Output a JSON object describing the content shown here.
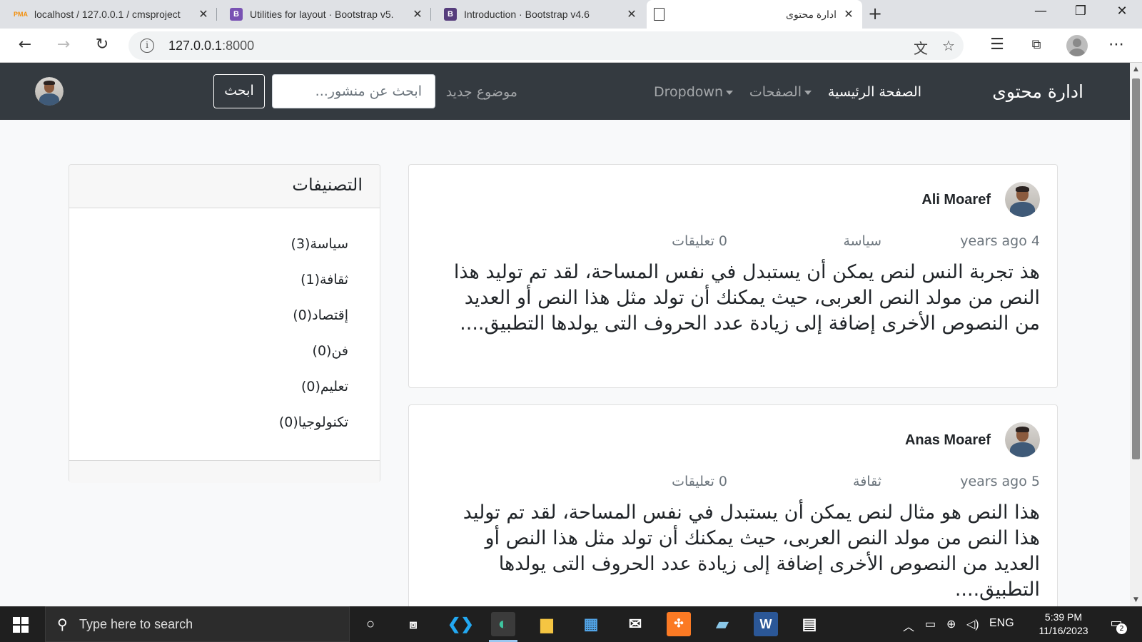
{
  "browser": {
    "tabs": [
      {
        "title": "localhost / 127.0.0.1 / cmsproject",
        "favicon": "PMA"
      },
      {
        "title": "Utilities for layout · Bootstrap v5.",
        "favicon": "B"
      },
      {
        "title": "Introduction · Bootstrap v4.6",
        "favicon": "B"
      },
      {
        "title": "ادارة محتوى",
        "favicon": ""
      }
    ],
    "url_host": "127.0.0.1",
    "url_port": ":8000"
  },
  "site": {
    "brand": "ادارة محتوى",
    "nav": {
      "home": "الصفحة الرئيسية",
      "pages": "الصفحات",
      "dropdown": "Dropdown",
      "new_topic": "موضوع جديد"
    },
    "search": {
      "placeholder": "ابحث عن منشور...",
      "button": "ابحث"
    }
  },
  "posts": [
    {
      "author": "Ali Moaref",
      "time": "4 years ago",
      "category": "سياسة",
      "comments": "0 تعليقات",
      "excerpt": "هذ تجربة النس لنص يمكن أن يستبدل في نفس المساحة، لقد تم توليد هذا النص من مولد النص العربى، حيث يمكنك أن تولد مثل هذا النص أو العديد من النصوص الأخرى إضافة إلى زيادة عدد الحروف التى يولدها التطبيق...."
    },
    {
      "author": "Anas Moaref",
      "time": "5 years ago",
      "category": "ثقافة",
      "comments": "0 تعليقات",
      "excerpt": "هذا النص هو مثال لنص يمكن أن يستبدل في نفس المساحة، لقد تم توليد هذا النص من مولد النص العربى، حيث يمكنك أن تولد مثل هذا النص أو العديد من النصوص الأخرى إضافة إلى زيادة عدد الحروف التى يولدها التطبيق...."
    }
  ],
  "sidebar": {
    "title": "التصنيفات",
    "categories": [
      "سياسة(3)",
      "ثقافة(1)",
      "إقتصاد(0)",
      "فن(0)",
      "تعليم(0)",
      "تكنولوجيا(0)"
    ]
  },
  "taskbar": {
    "search_placeholder": "Type here to search",
    "language": "ENG",
    "time": "5:39 PM",
    "date": "11/16/2023",
    "notification_count": "2",
    "apps": [
      "cortana-icon",
      "task-view-icon",
      "vscode-icon",
      "edge-icon",
      "file-explorer-icon",
      "store-icon",
      "mail-icon",
      "xampp-icon",
      "notepad-icon",
      "word-icon",
      "video-editor-icon"
    ]
  },
  "colors": {
    "navbar": "#343a40",
    "tab_strip": "#dfe1e5",
    "page_bg": "#f8f9fa",
    "taskbar": "#1f1f1f"
  }
}
